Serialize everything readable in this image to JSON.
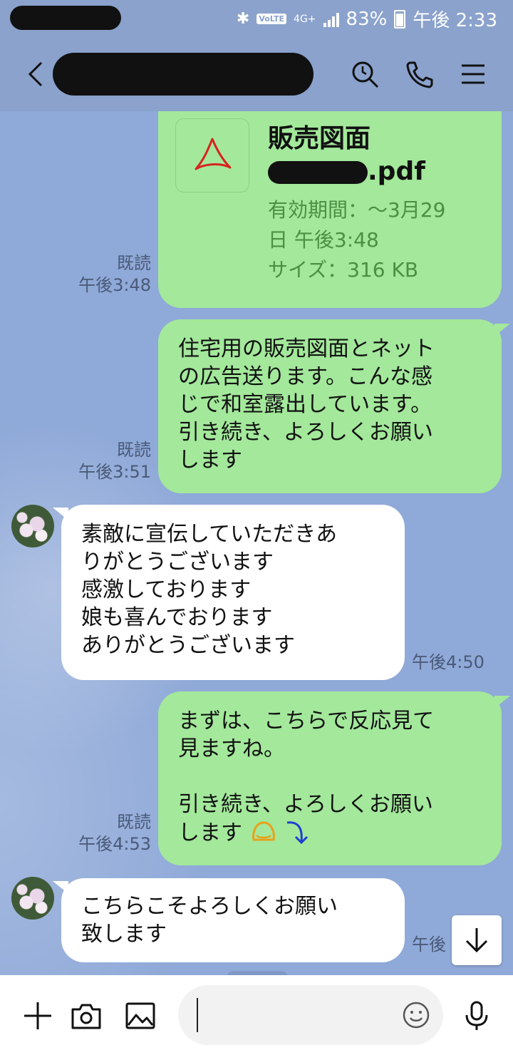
{
  "status_bar": {
    "network": "4G+",
    "volte": "VoLTE",
    "battery": "83%",
    "time": "午後 2:33"
  },
  "header": {
    "back_icon": "chevron-left-icon",
    "search_icon": "search-icon",
    "call_icon": "phone-icon",
    "menu_icon": "menu-icon"
  },
  "messages": {
    "pdf": {
      "title": "販売図面",
      "name_suffix": ".pdf",
      "expiry": "有効期間：～3月29日 午後3:48",
      "size": "サイズ：316 KB",
      "read": "既読",
      "time": "午後3:48"
    },
    "m1": {
      "lines": [
        "住宅用の販売図面とネット",
        "の広告送ります。こんな感",
        "じで和室露出しています。",
        "引き続き、よろしくお願い",
        "します"
      ],
      "read": "既読",
      "time": "午後3:51"
    },
    "m2": {
      "lines": [
        "素敵に宣伝していただきあ",
        "りがとうございます",
        "感激しております",
        "娘も喜んでおります",
        "ありがとうございます"
      ],
      "time": "午後4:50"
    },
    "m3": {
      "lines": [
        "まずは、こちらで反応見て",
        "見ますね。",
        "",
        "引き続き、よろしくお願い",
        "します"
      ],
      "read": "既読",
      "time": "午後4:53"
    },
    "m4": {
      "lines": [
        "こちらこそよろしくお願い",
        "致します"
      ],
      "time": "午後"
    }
  },
  "input": {
    "plus_icon": "plus-icon",
    "camera_icon": "camera-icon",
    "image_icon": "image-icon",
    "emoji_icon": "emoji-icon",
    "mic_icon": "microphone-icon",
    "placeholder": ""
  },
  "colors": {
    "outgoing_bubble": "#a3e89b",
    "incoming_bubble": "#ffffff",
    "background": "#8fa9d8",
    "meta_text": "#4a5a78"
  }
}
